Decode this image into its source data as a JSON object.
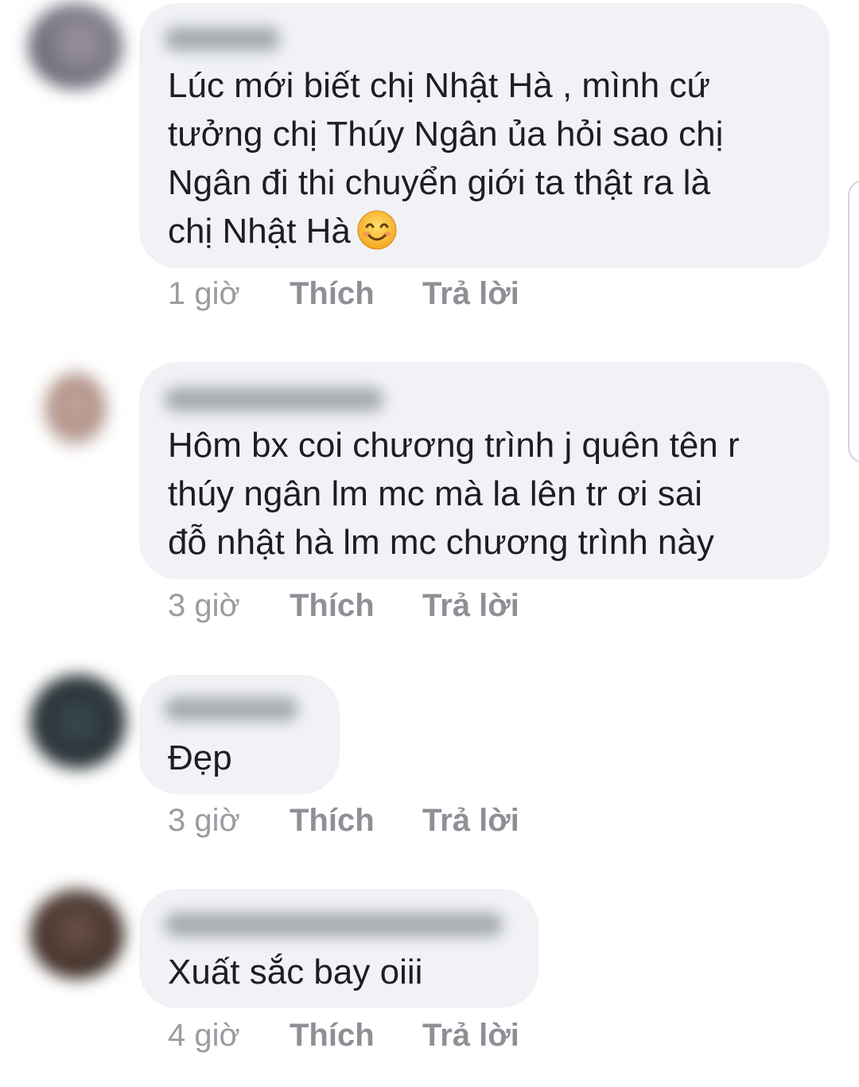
{
  "comments": [
    {
      "text_lines": [
        "Lúc mới biết chị Nhật Hà , mình cứ",
        "tưởng chị Thúy Ngân ủa hỏi sao chị",
        "Ngân đi thi chuyển giới ta thật ra là",
        "chị Nhật Hà"
      ],
      "emoji": "smiling-face-icon",
      "time": "1 giờ",
      "like_label": "Thích",
      "reply_label": "Trả lời"
    },
    {
      "text_lines": [
        "Hôm bx coi chương trình j quên tên r",
        "thúy ngân lm mc mà la lên tr ơi sai",
        "đỗ nhật hà lm mc chương trình này"
      ],
      "time": "3 giờ",
      "like_label": "Thích",
      "reply_label": "Trả lời"
    },
    {
      "text_lines": [
        "Đẹp"
      ],
      "time": "3 giờ",
      "like_label": "Thích",
      "reply_label": "Trả lời"
    },
    {
      "text_lines": [
        "Xuất sắc bay oiii"
      ],
      "time": "4 giờ",
      "like_label": "Thích",
      "reply_label": "Trả lời"
    }
  ],
  "colors": {
    "bubble": "#f0f2f5",
    "text": "#1c1e21",
    "meta": "#9a9ca1",
    "emoji_face": "#fbc52f"
  }
}
